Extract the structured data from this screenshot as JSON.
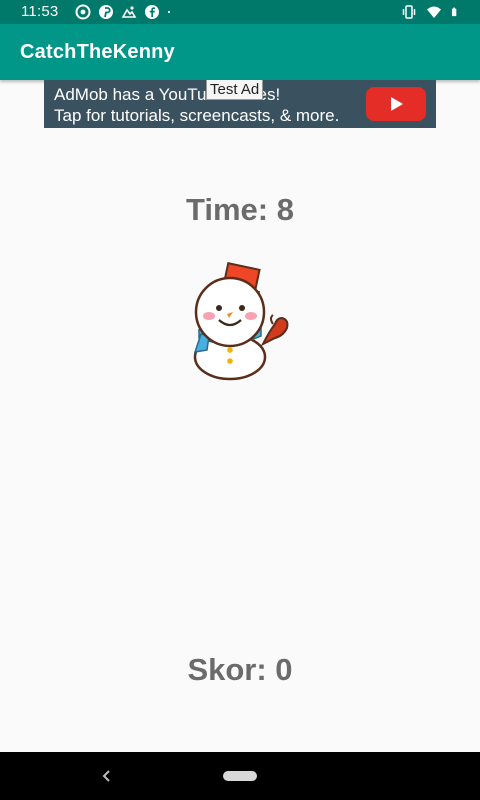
{
  "status_bar": {
    "time": "11:53",
    "icons_left": [
      "chrome-icon",
      "pinterest-icon",
      "photos-icon",
      "facebook-icon",
      "dot-icon"
    ],
    "icons_right": [
      "vibrate-icon",
      "wifi-icon",
      "battery-icon"
    ]
  },
  "app_bar": {
    "title": "CatchTheKenny"
  },
  "ad": {
    "label": "Test Ad",
    "line1": "AdMob has a YouTube series!",
    "line2": "Tap for tutorials, screencasts, & more.",
    "play_icon": "youtube-play-icon"
  },
  "game": {
    "time_text": "Time: 8",
    "score_text": "Skor: 0",
    "kenny_icon": "snowman-icon"
  },
  "nav_bar": {
    "back_icon": "back-chevron-icon",
    "home_icon": "home-pill-icon"
  },
  "colors": {
    "primary": "#009688",
    "primary_dark": "#00796b",
    "text_gray": "#6b6b6b",
    "ad_bg": "#3a5160"
  }
}
